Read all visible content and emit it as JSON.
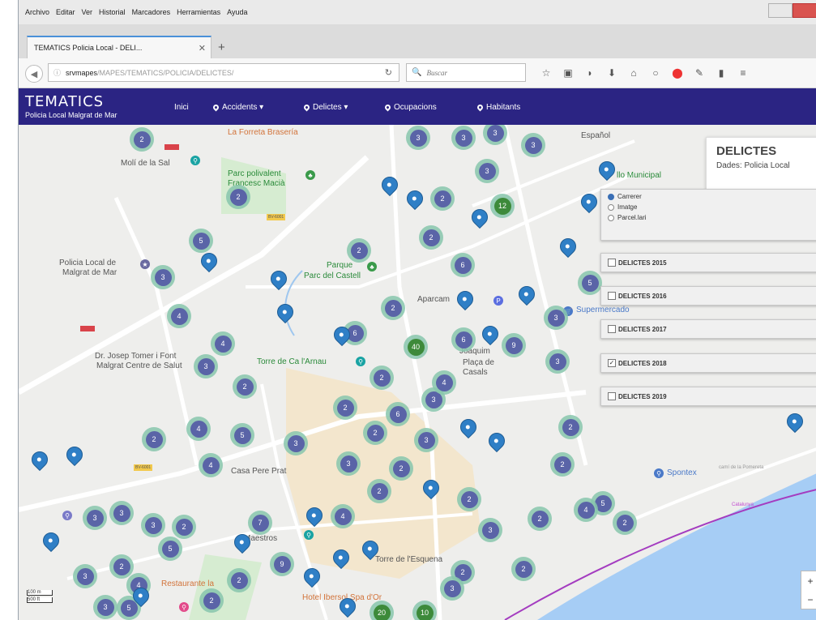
{
  "menubar": [
    "Archivo",
    "Editar",
    "Ver",
    "Historial",
    "Marcadores",
    "Herramientas",
    "Ayuda"
  ],
  "tab": {
    "title": "TEMATICS Policia Local - DELI..."
  },
  "url": {
    "host": "srvmapes",
    "path": "/MAPES/TEMATICS/POLICIA/DELICTES/"
  },
  "search": {
    "placeholder": "Buscar"
  },
  "app": {
    "brand_title": "TEMATICS",
    "brand_sub": "Policia Local Malgrat de Mar",
    "nav": {
      "home": "Inici",
      "accidents": "Accidents",
      "delictes": "Delictes",
      "ocupacions": "Ocupacions",
      "habitants": "Habitants"
    }
  },
  "info_panel": {
    "title": "DELICTES",
    "subtitle": "Dades: Policia Local"
  },
  "radios": [
    {
      "label": "Carrerer",
      "checked": true
    },
    {
      "label": "Imatge",
      "checked": false
    },
    {
      "label": "Parcel.lari",
      "checked": false
    }
  ],
  "layers": [
    {
      "label": "DELICTES 2015",
      "checked": false
    },
    {
      "label": "DELICTES 2016",
      "checked": false
    },
    {
      "label": "DELICTES 2017",
      "checked": false
    },
    {
      "label": "DELICTES 2018",
      "checked": true
    },
    {
      "label": "DELICTES 2019",
      "checked": false
    }
  ],
  "map_labels": {
    "molí": "Molí de la Sal",
    "parc_poli": "Parc polivalent",
    "macia": "Francesc Macià",
    "policia": "Policia Local de",
    "malgrat": "Malgrat de Mar",
    "parque": "Parque",
    "parc_castell": "Parc del Castell",
    "torre": "Torre de Ca l'Arnau",
    "tomer": "Dr. Josep Tomer i Font",
    "centre": "Malgrat Centre de Salut",
    "pere": "Casa Pere Prat",
    "maestros": "Maestros",
    "esquena": "Torre de l'Esquena",
    "spontex": "Spontex",
    "forreta": "La Forreta Brasería",
    "espanol": "Español",
    "municipal": "llo Municipal",
    "aparca": "Aparcam",
    "supermercado": "Supermercado",
    "joaquim": "Joaquim",
    "placa_casals": "Plaça de",
    "casals": "Casals",
    "restaurante": "Restaurante la",
    "hotel": "Hotel Ibersol Spa d'Or",
    "carrer_pomereta": "camí de la Pomereta",
    "catalunya": "Catalunya"
  },
  "scale": {
    "m": "100 m",
    "ft": "500 ft"
  },
  "clusters": [
    "2",
    "2",
    "3",
    "3",
    "3",
    "3",
    "3",
    "12",
    "2",
    "5",
    "2",
    "2",
    "3",
    "6",
    "6",
    "5",
    "4",
    "2",
    "3",
    "6",
    "9",
    "3",
    "2",
    "4",
    "40",
    "3",
    "2",
    "4",
    "2",
    "3",
    "6",
    "4",
    "2",
    "5",
    "3",
    "2",
    "3",
    "2",
    "4",
    "3",
    "2",
    "2",
    "2",
    "3",
    "4",
    "3",
    "5",
    "4",
    "2",
    "3",
    "2",
    "3",
    "2",
    "2",
    "7",
    "5",
    "2",
    "9",
    "3",
    "4",
    "2",
    "2",
    "2",
    "3",
    "20",
    "10",
    "2",
    "3",
    "5"
  ],
  "cluster_colors": {
    "ring": "#87c5ad",
    "inner": "#5a64a7",
    "green": "#3d8a3a"
  },
  "marker_color": "#2f7fc6",
  "navbar_color": "#2b2483"
}
